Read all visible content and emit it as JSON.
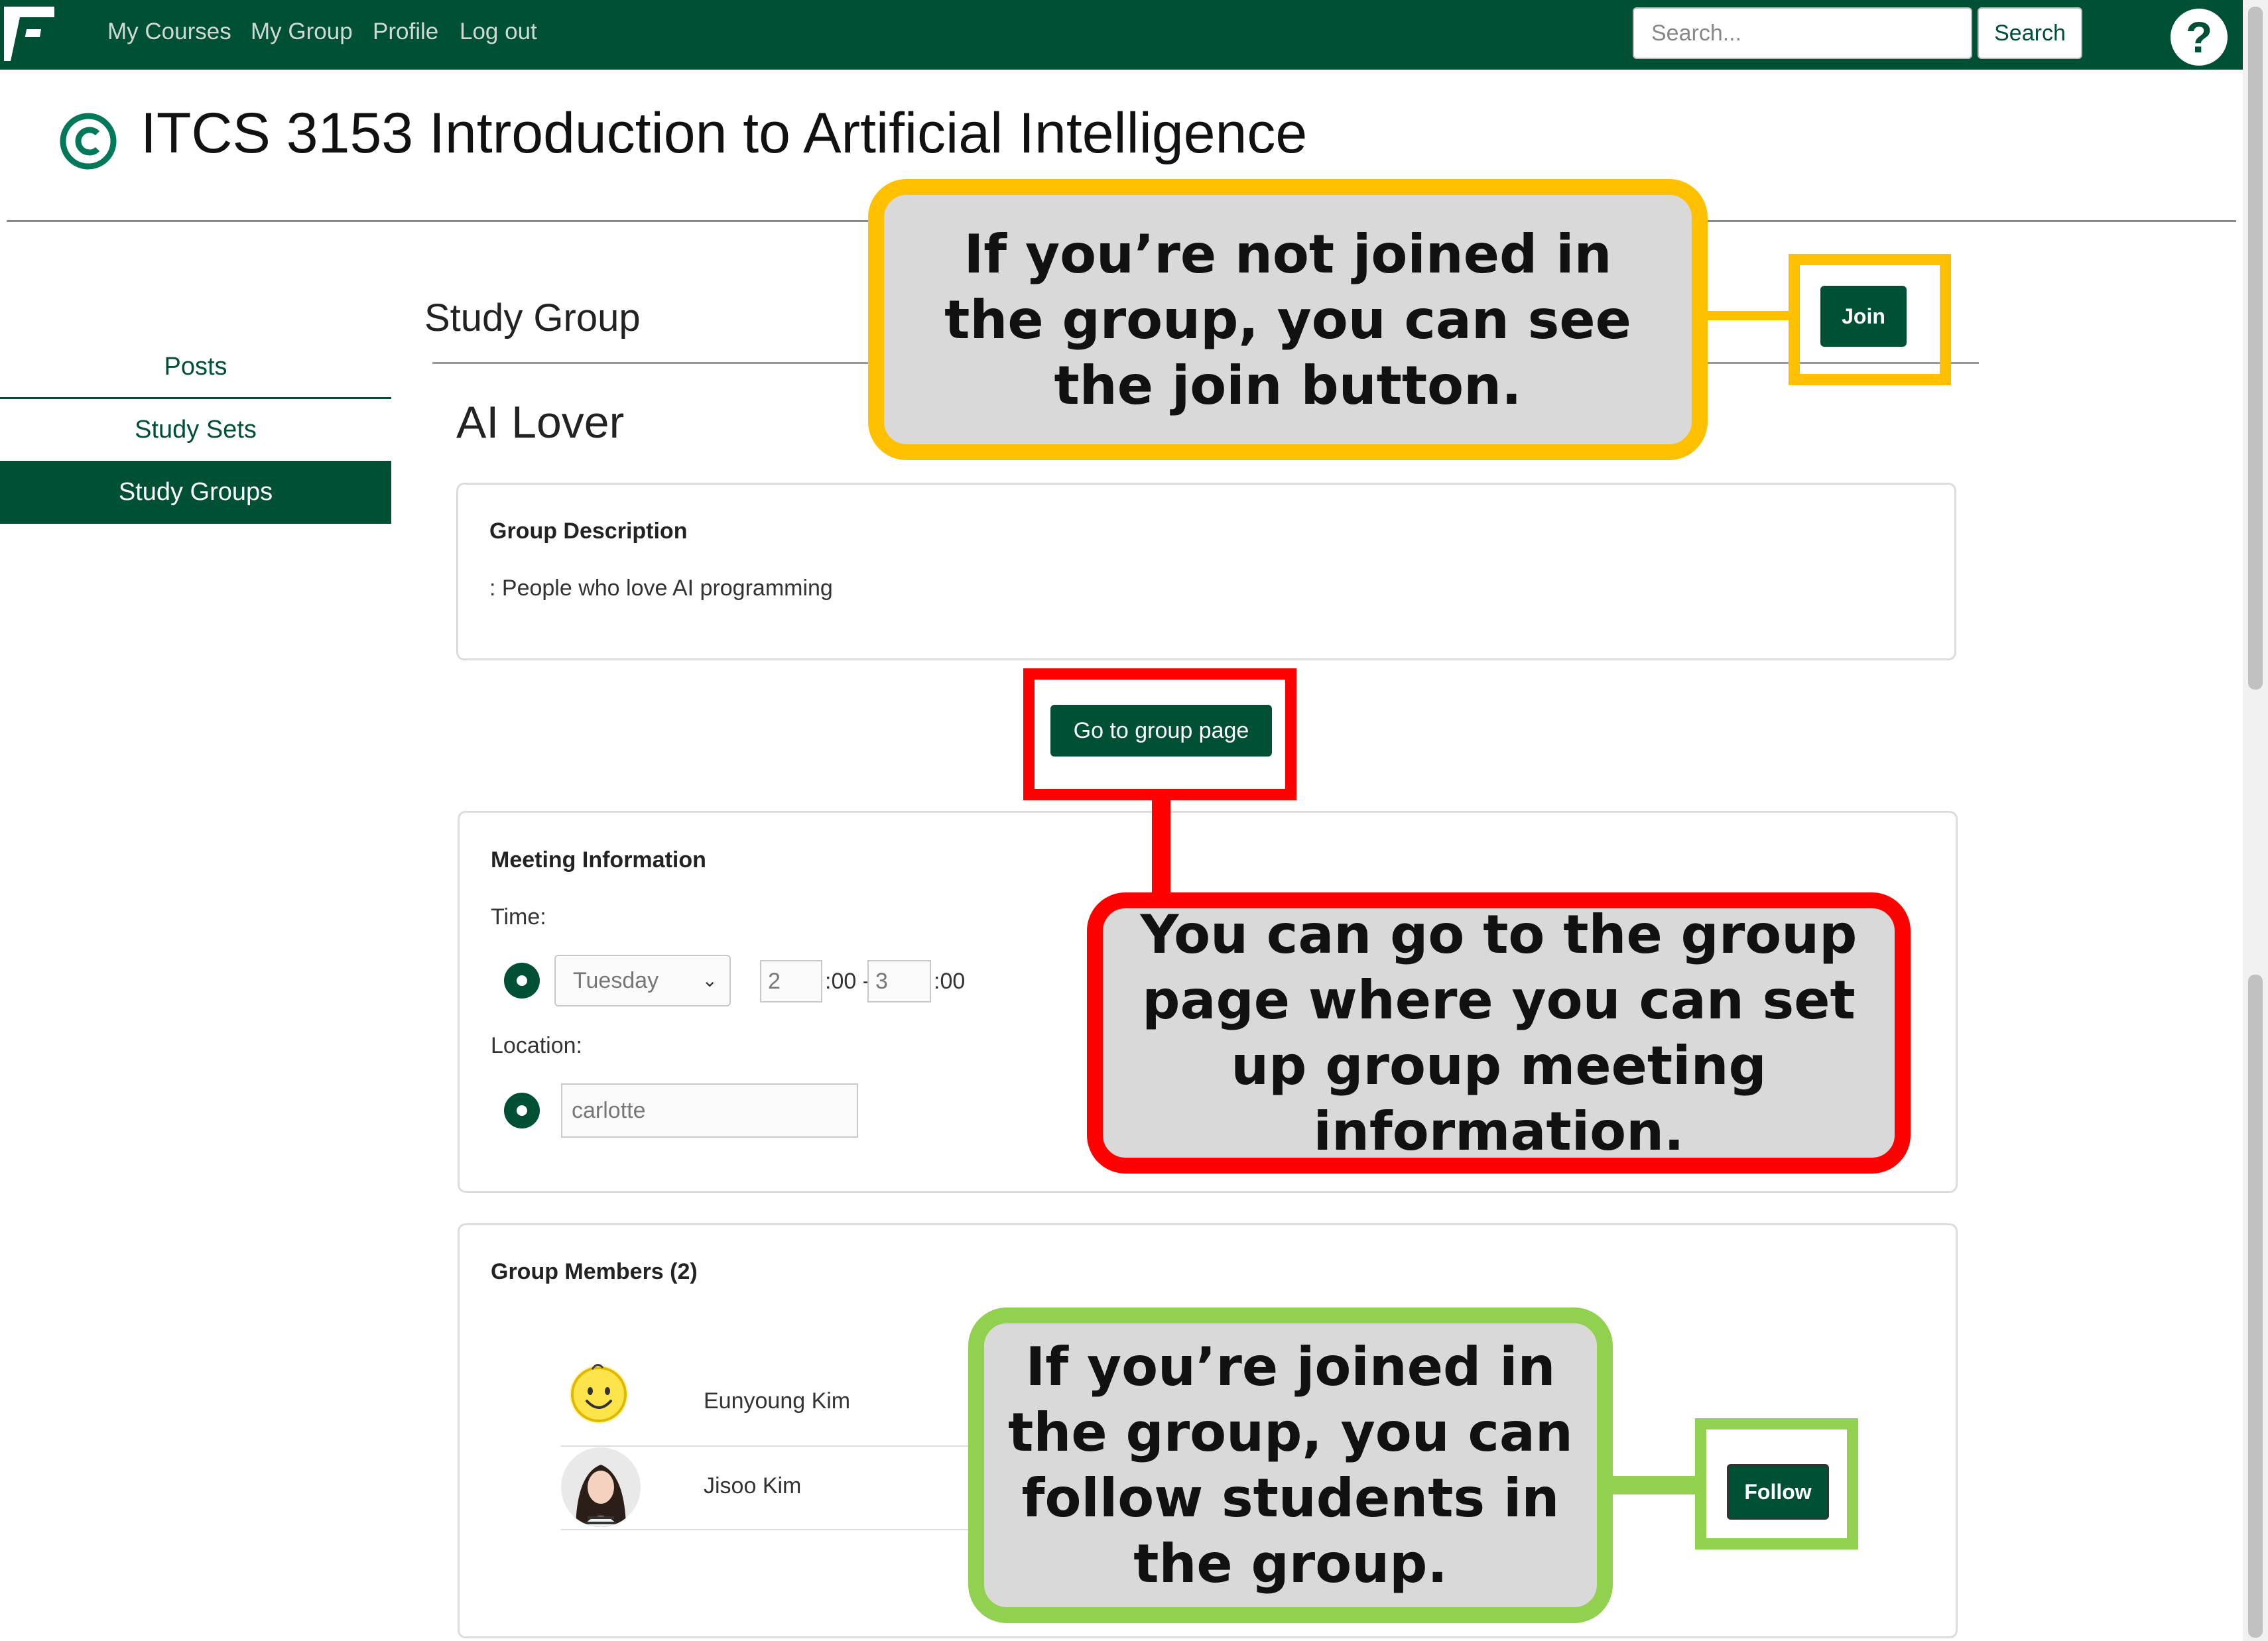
{
  "nav": {
    "links": [
      "My Courses",
      "My Group",
      "Profile",
      "Log out"
    ],
    "search_placeholder": "Search...",
    "search_button": "Search",
    "help_label": "?"
  },
  "course": {
    "title": "ITCS 3153 Introduction to Artificial Intelligence"
  },
  "sidebar": {
    "items": [
      {
        "label": "Posts",
        "active": false
      },
      {
        "label": "Study Sets",
        "active": false
      },
      {
        "label": "Study Groups",
        "active": true
      }
    ]
  },
  "main": {
    "section_title": "Study Group",
    "join_button": "Join",
    "group_name": "AI Lover",
    "description": {
      "heading": "Group Description",
      "text": ": People who love AI programming"
    },
    "go_button": "Go to group page",
    "meeting": {
      "heading": "Meeting Information",
      "time_label": "Time:",
      "day": "Tuesday",
      "start_hour": "2",
      "start_suffix": ":00 -",
      "end_hour": "3",
      "end_suffix": ":00",
      "location_label": "Location:",
      "location": "carlotte"
    },
    "members": {
      "heading": "Group Members (2)",
      "list": [
        {
          "name": "Eunyoung Kim"
        },
        {
          "name": "Jisoo Kim"
        }
      ],
      "follow_button": "Follow"
    }
  },
  "callouts": {
    "join": "If you’re not joined in the group, you can see the join button.",
    "group_page": "You can go to the group page where you can set up group meeting information.",
    "follow": "If you’re joined in the group, you can follow students in the group."
  },
  "colors": {
    "brand_green": "#005035",
    "callout_yellow": "#FFC000",
    "callout_red": "#FF0000",
    "callout_green": "#92D050",
    "callout_fill": "#D9D9D9"
  }
}
